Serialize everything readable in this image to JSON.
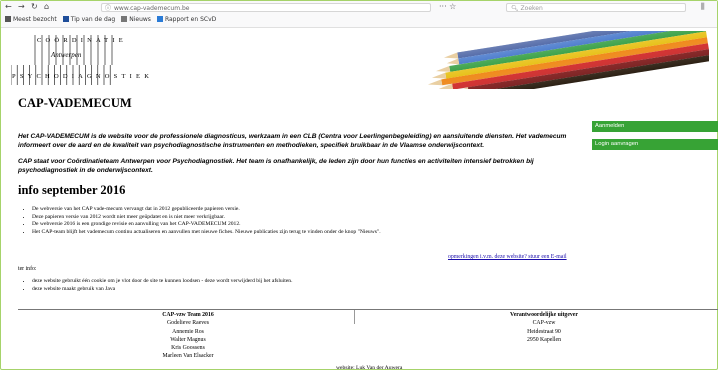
{
  "browser": {
    "url": "www.cap-vademecum.be",
    "search_placeholder": "Zoeken",
    "bookmarks": [
      {
        "label": "Meest bezocht",
        "icon": "gear-icon",
        "color": "#555555"
      },
      {
        "label": "Tip van de dag",
        "icon": "calendar-icon",
        "color": "#1f4e9a"
      },
      {
        "label": "Nieuws",
        "icon": "newspaper-icon",
        "color": "#777777"
      },
      {
        "label": "Rapport en SCvD",
        "icon": "report-icon",
        "color": "#2a7bd6"
      }
    ]
  },
  "logo": {
    "top": "COÖRDINATIE",
    "middle": "Antwerpen",
    "bottom": "PSYCHODIAGNOSTIEK"
  },
  "page": {
    "title": "CAP-VADEMECUM",
    "intro_1": "Het CAP-VADEMECUM is de website voor de professionele diagnosticus, werkzaam in een CLB (Centra voor Leerlingenbegeleiding) en aansluitende diensten. Het vademecum informeert over de aard en de kwaliteit van psychodiagnostische instrumenten en methodieken, specifiek bruikbaar in de Vlaamse onderwijscontext.",
    "intro_2": "CAP staat voor Coördinatieteam Antwerpen voor Psychodiagnostiek. Het team is onafhankelijk, de leden zijn door hun functies en activiteiten intensief betrokken bij psychodiagnostiek in de onderwijscontext.",
    "news_heading": "info september 2016",
    "news_items": [
      "De webversie van het CAP vade-mecum vervangt dat in 2012 gepubliceerde papieren versie.",
      "Deze papieren versie van 2012 wordt niet meer geüpdatet en is niet meer verkrijgbaar.",
      "De webversie 2016 is een grondige revisie en aanvulling van het CAP-VADEMECUM 2012.",
      "Het CAP-team blijft het vademecum continu actualiseren en aanvullen met nieuwe fiches. Nieuwe publicaties zijn terug te vinden onder de knop \"Nieuws\"."
    ],
    "contact_link": "opmerkingen i.v.m. deze website? stuur een E-mail",
    "notes_heading": "ter info:",
    "notes": [
      "deze website gebruikt één cookie om je vlot door de site te kunnen loodsen - deze wordt verwijderd bij het afsluiten.",
      "deze website maakt gebruik van Java"
    ]
  },
  "sidebar": {
    "buttons": [
      "Aanmelden",
      "Login aanvragen"
    ],
    "color": "#37a335"
  },
  "footer": {
    "left_heading": "CAP-vzw Team 2016",
    "left_names": [
      "Godelieve Raeves",
      "Annemie Ros",
      "Walter Magnus",
      "Kris Goossens",
      "Marleen Van Elsacker"
    ],
    "right_heading": "Verantwoordelijke uitgever",
    "right_lines": [
      "CAP-vzw",
      "Heidestraat 90",
      "2950 Kapellen"
    ],
    "website_credit": "website: Luk Van der Auwera"
  }
}
